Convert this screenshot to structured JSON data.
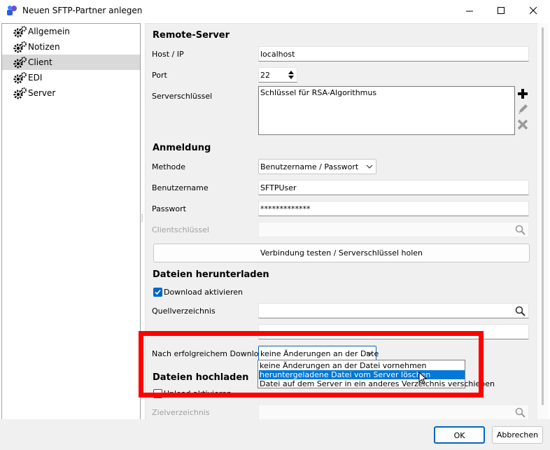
{
  "window": {
    "title": "Neuen SFTP-Partner anlegen"
  },
  "sidebar": {
    "items": [
      {
        "label": "Allgemein"
      },
      {
        "label": "Notizen"
      },
      {
        "label": "Client"
      },
      {
        "label": "EDI"
      },
      {
        "label": "Server"
      }
    ]
  },
  "remote_server": {
    "heading": "Remote-Server",
    "host_label": "Host / IP",
    "host_value": "localhost",
    "port_label": "Port",
    "port_value": "22",
    "key_label": "Serverschlüssel",
    "key_value": "Schlüssel für RSA-Algorithmus"
  },
  "login": {
    "heading": "Anmeldung",
    "method_label": "Methode",
    "method_value": "Benutzername / Passwort",
    "user_label": "Benutzername",
    "user_value": "SFTPUser",
    "password_label": "Passwort",
    "password_value": "*************",
    "client_key_label": "Clientschlüssel",
    "test_button": "Verbindung testen / Serverschlüssel holen"
  },
  "download": {
    "heading": "Dateien herunterladen",
    "enable_label": "Download aktivieren",
    "enabled": true,
    "source_label": "Quellverzeichnis",
    "after_label": "Nach erfolgreichem Download..",
    "after_value": "keine Änderungen an der Date",
    "options": [
      "keine Änderungen an der Datei vornehmen",
      "heruntergeladene Datei vom Server löschen",
      "Datei auf dem Server in ein anderes Verzeichnis verschieben"
    ],
    "selected_option": 1
  },
  "upload": {
    "heading": "Dateien hochladen",
    "enable_label": "Upload aktivieren",
    "enabled": false,
    "target_label": "Zielverzeichnis"
  },
  "footer": {
    "ok": "OK",
    "cancel": "Abbrechen"
  },
  "colors": {
    "accent": "#0078d7",
    "highlight": "#ff0000"
  },
  "icons": [
    "app-icon",
    "minimize-icon",
    "maximize-icon",
    "close-icon",
    "gear-icon",
    "plus-icon",
    "pencil-icon",
    "delete-icon",
    "search-icon",
    "chevron-down-icon",
    "checkmark-icon",
    "cursor-icon"
  ]
}
